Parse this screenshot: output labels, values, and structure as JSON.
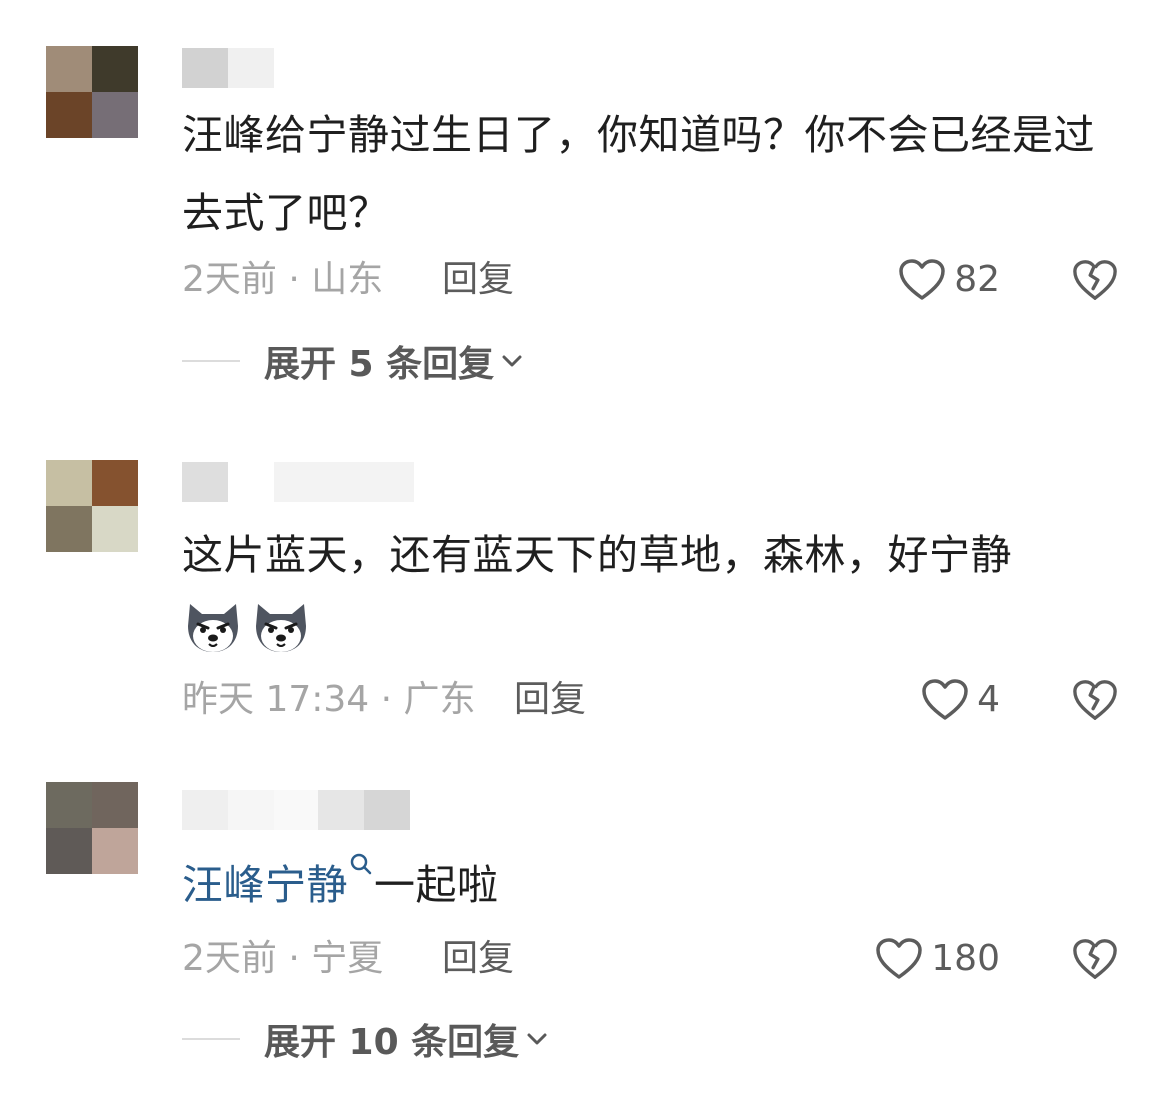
{
  "comments": [
    {
      "text": "汪峰给宁静过生日了，你知道吗？你不会已经是过去式了吧？",
      "meta": "2天前 · 山东",
      "reply_label": "回复",
      "like_count": "82",
      "expand_label": "展开 5 条回复"
    },
    {
      "text": "这片蓝天，还有蓝天下的草地，森林，好宁静",
      "emojis": [
        "husky-dog-emoji",
        "husky-dog-emoji"
      ],
      "meta": "昨天 17:34 · 广东",
      "reply_label": "回复",
      "like_count": "4"
    },
    {
      "mention": "汪峰宁静",
      "text_after": "一起啦",
      "meta": "2天前 · 宁夏",
      "reply_label": "回复",
      "like_count": "180",
      "expand_label": "展开 10 条回复"
    }
  ],
  "icons": {
    "like": "heart-icon",
    "dislike": "broken-heart-icon",
    "expand": "chevron-down-icon",
    "search": "search-icon"
  },
  "colors": {
    "text": "#1f1f1f",
    "meta": "#a5a5a5",
    "action": "#5c5c5c",
    "mention": "#2a5d8c"
  }
}
